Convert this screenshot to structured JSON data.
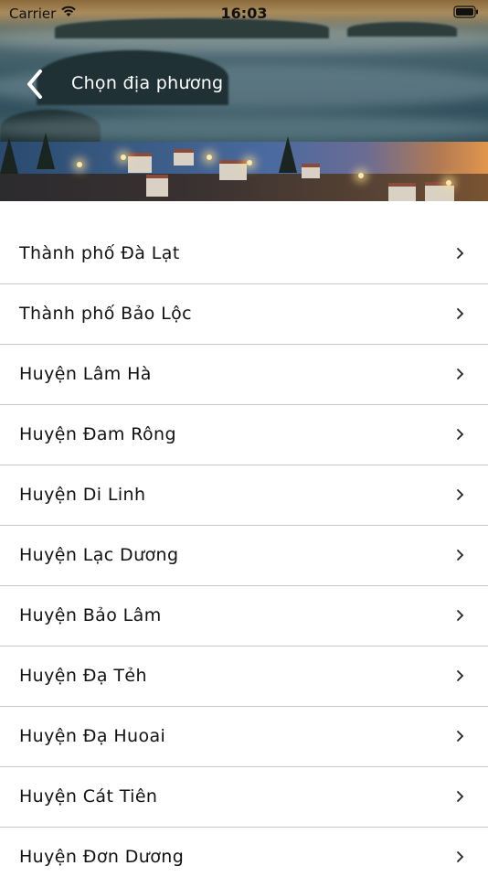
{
  "status_bar": {
    "carrier": "Carrier",
    "time": "16:03"
  },
  "header": {
    "title": "Chọn địa phương",
    "back_icon": "chevron-left-icon"
  },
  "localities": [
    {
      "label": "Thành phố Đà Lạt"
    },
    {
      "label": "Thành phố Bảo Lộc"
    },
    {
      "label": "Huyện Lâm Hà"
    },
    {
      "label": "Huyện Đam Rông"
    },
    {
      "label": "Huyện Di Linh"
    },
    {
      "label": "Huyện Lạc Dương"
    },
    {
      "label": "Huyện Bảo Lâm"
    },
    {
      "label": "Huyện Đạ Tẻh"
    },
    {
      "label": "Huyện Đạ Huoai"
    },
    {
      "label": "Huyện Cát Tiên"
    },
    {
      "label": "Huyện Đơn Dương"
    }
  ],
  "row_icon": "chevron-right-icon"
}
